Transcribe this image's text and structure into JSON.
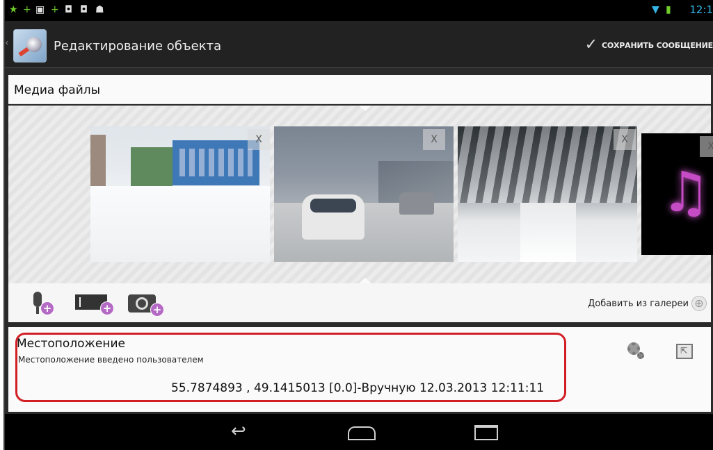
{
  "status_bar": {
    "notification_icons": [
      "star-icon",
      "plus-icon",
      "image-icon",
      "plus-icon",
      "bag-icon",
      "bag-icon",
      "android-icon"
    ],
    "time": "12:1"
  },
  "action_bar": {
    "title": "Редактирование объекта",
    "save_label": "СОХРАНИТЬ СООБЩЕНИЕ"
  },
  "media": {
    "title": "Медиа файлы",
    "items": [
      {
        "type": "photo",
        "close": "X"
      },
      {
        "type": "photo",
        "close": "X"
      },
      {
        "type": "photo",
        "close": "X"
      },
      {
        "type": "audio",
        "close": "X"
      }
    ],
    "add_from_gallery": "Добавить из галереи"
  },
  "location": {
    "title": "Местоположение",
    "subtitle": "Местоположение введено пользователем",
    "coords": "55.7874893 , 49.1415013  [0.0]-Вручную 12.03.2013 12:11:11"
  },
  "colors": {
    "accent": "#33b5e5",
    "highlight_border": "#d21f26",
    "add_badge": "#b46ac4"
  }
}
